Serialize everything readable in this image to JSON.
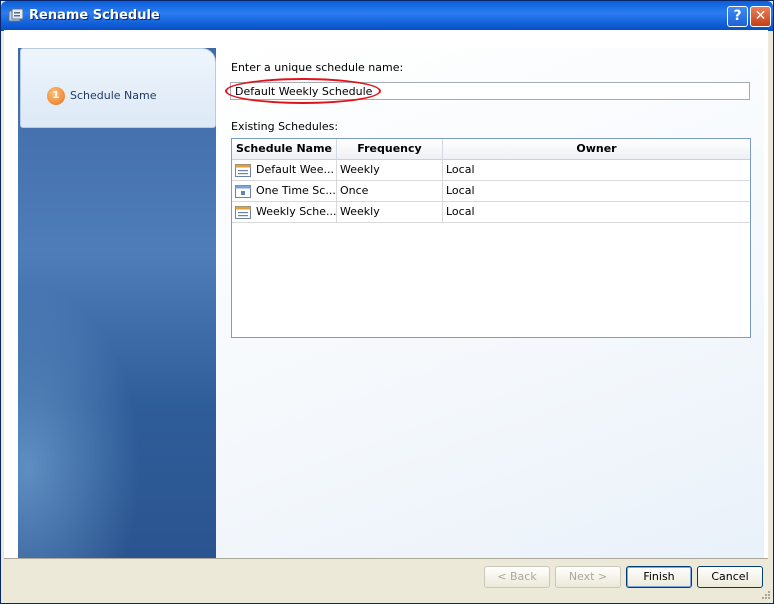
{
  "window": {
    "title": "Rename Schedule",
    "help_glyph": "?",
    "close_glyph": "✕"
  },
  "steps": [
    {
      "number": "1",
      "label": "Schedule Name"
    }
  ],
  "form": {
    "name_label": "Enter a unique schedule name:",
    "name_value": "Default Weekly Schedule",
    "existing_label": "Existing Schedules:"
  },
  "table": {
    "columns": [
      "Schedule Name",
      "Frequency",
      "Owner"
    ],
    "rows": [
      {
        "name": "Default Wee...",
        "frequency": "Weekly",
        "owner": "Local",
        "icon": "calendar-icon"
      },
      {
        "name": "One Time Sc...",
        "frequency": "Once",
        "owner": "Local",
        "icon": "calendar-once-icon"
      },
      {
        "name": "Weekly Sche...",
        "frequency": "Weekly",
        "owner": "Local",
        "icon": "calendar-icon"
      }
    ]
  },
  "buttons": {
    "back": "< Back",
    "next": "Next >",
    "finish": "Finish",
    "cancel": "Cancel"
  },
  "colors": {
    "title_bar": "#0a5fd8",
    "highlight_oval": "#e0141b",
    "step_badge": "#e66e1b"
  }
}
